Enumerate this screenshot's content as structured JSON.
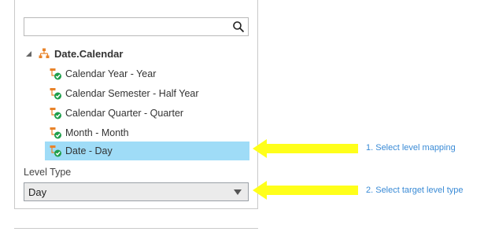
{
  "search": {
    "value": "",
    "placeholder": "",
    "icon": "search-icon"
  },
  "tree": {
    "root_label": "Date.Calendar",
    "items": [
      {
        "label": "Calendar Year - Year"
      },
      {
        "label": "Calendar Semester - Half Year"
      },
      {
        "label": "Calendar Quarter - Quarter"
      },
      {
        "label": "Month - Month"
      },
      {
        "label": "Date - Day",
        "selected": true
      }
    ]
  },
  "level_type": {
    "label": "Level Type",
    "selected": "Day"
  },
  "annotations": {
    "step1": "1.  Select level mapping",
    "step2": "2. Select target level type"
  },
  "colors": {
    "selection": "#9fdcf7",
    "annotation_arrow": "#ffff1a",
    "annotation_text": "#3a8bd6"
  }
}
